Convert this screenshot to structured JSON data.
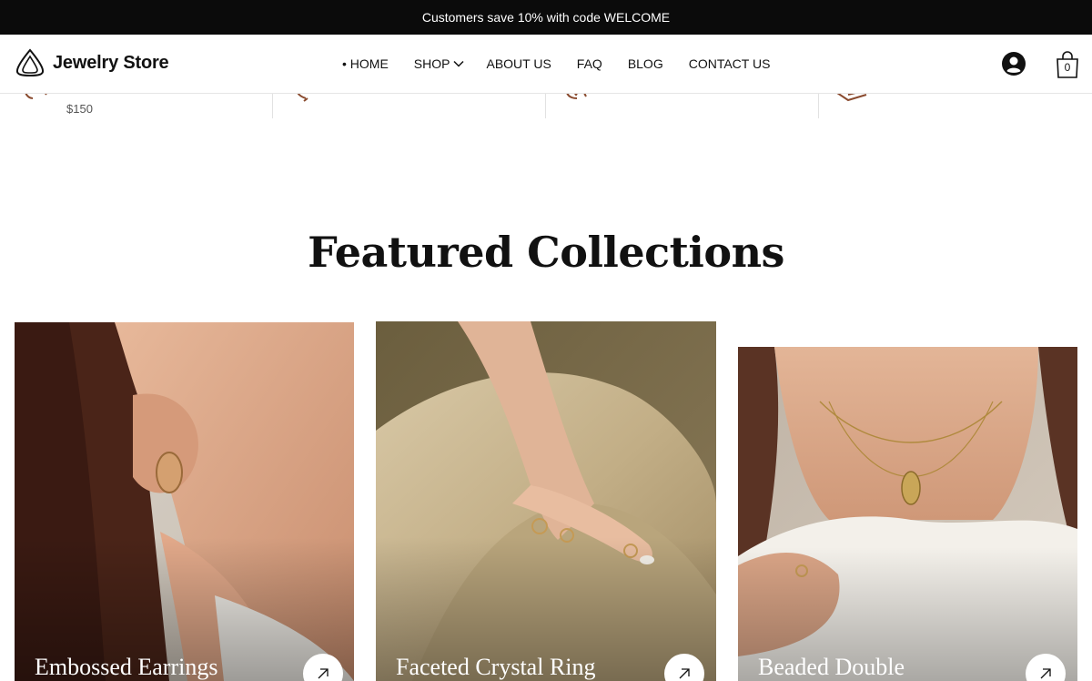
{
  "announcement": "Customers save 10% with code WELCOME",
  "brand": {
    "name": "Jewelry Store"
  },
  "nav": {
    "home": "• HOME",
    "shop": "SHOP",
    "about": "ABOUT US",
    "faq": "FAQ",
    "blog": "BLOG",
    "contact": "CONTACT US"
  },
  "cart": {
    "count": "0"
  },
  "feature_strip": {
    "price": "$150"
  },
  "section": {
    "title": "Featured Collections"
  },
  "collections": [
    {
      "label": "Embossed Earrings"
    },
    {
      "label": "Faceted Crystal Ring"
    },
    {
      "label": "Beaded Double"
    }
  ],
  "colors": {
    "accent": "#8a4b2f",
    "announcement_bg": "#0b0b0b"
  }
}
